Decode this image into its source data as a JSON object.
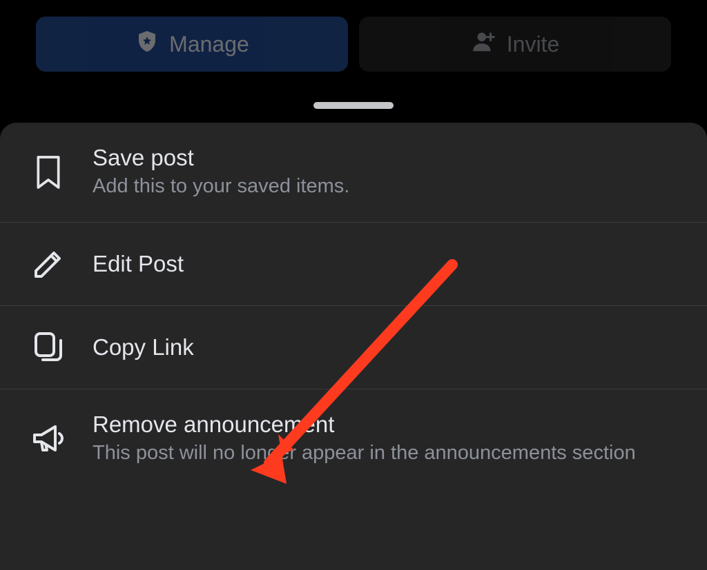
{
  "topButtons": {
    "manage": "Manage",
    "invite": "Invite"
  },
  "menu": {
    "savePost": {
      "title": "Save post",
      "subtitle": "Add this to your saved items."
    },
    "editPost": {
      "title": "Edit Post"
    },
    "copyLink": {
      "title": "Copy Link"
    },
    "removeAnnouncement": {
      "title": "Remove announcement",
      "subtitle": "This post will no longer appear in the announcements section"
    }
  }
}
